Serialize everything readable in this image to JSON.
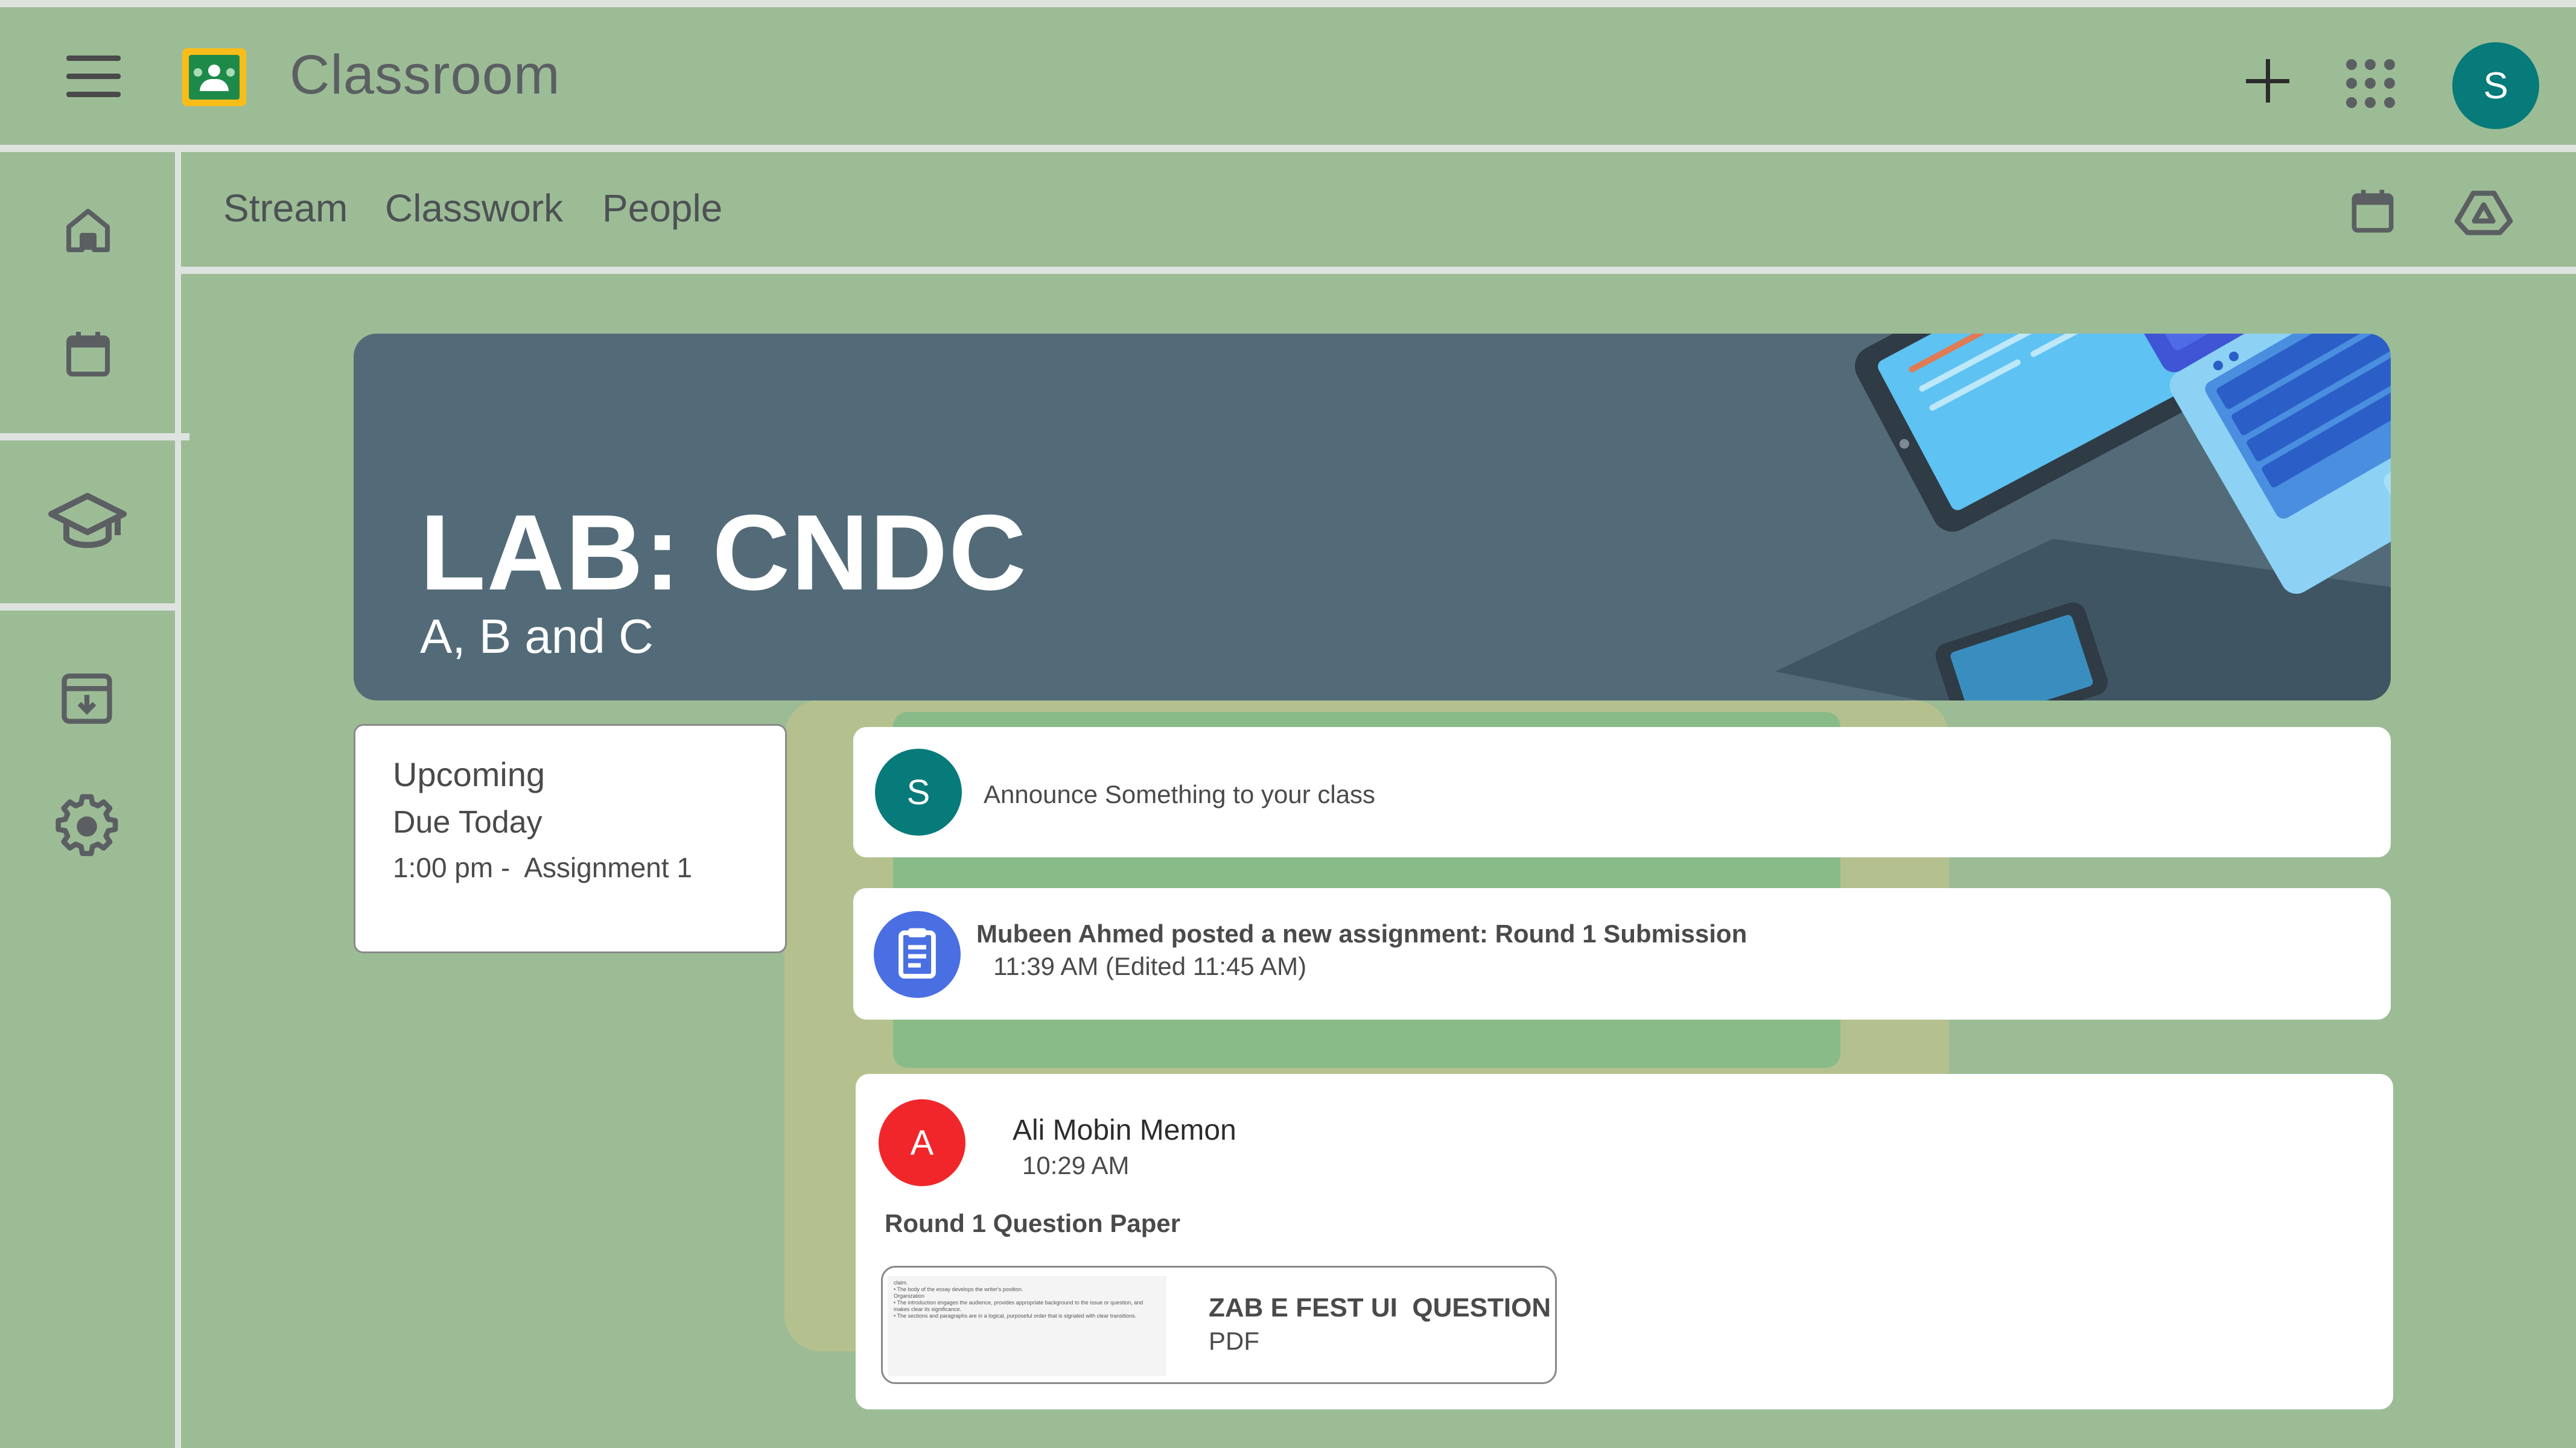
{
  "app": {
    "title": "Classroom"
  },
  "header": {
    "avatar_initial": "S"
  },
  "tabs": [
    {
      "label": "Stream"
    },
    {
      "label": "Classwork"
    },
    {
      "label": "People"
    }
  ],
  "banner": {
    "title": "LAB: CNDC",
    "subtitle": "A, B and C"
  },
  "upcoming": {
    "title": "Upcoming",
    "due_label": "Due Today",
    "item": "1:00 pm -  Assignment 1"
  },
  "announce": {
    "avatar_initial": "S",
    "placeholder": "Announce Something to your class"
  },
  "assignment_post": {
    "title": "Mubeen Ahmed posted a new assignment: Round 1 Submission",
    "time": "11:39 AM (Edited 11:45 AM)"
  },
  "post": {
    "avatar_initial": "A",
    "author": "Ali Mobin Memon",
    "time": "10:29 AM",
    "body": "Round 1 Question Paper",
    "attachment": {
      "thumbnail_text": "claim.\n• The body of the essay develops the writer's position.\nOrganization\n• The introduction engages the audience, provides appropriate background to the issue or question, and makes clear its significance.\n• The sections and paragraphs are in a logical, purposeful order that is signaled with clear transitions.",
      "name": "ZAB E FEST UI  QUESTION",
      "type": "PDF"
    }
  },
  "icons": {
    "menu": "menu-icon",
    "logo": "classroom-logo-icon",
    "plus": "plus-icon",
    "apps": "apps-grid-icon",
    "home": "home-icon",
    "calendar": "calendar-icon",
    "enrolled": "graduation-cap-icon",
    "archive": "archive-icon",
    "settings": "gear-icon",
    "drive": "drive-icon",
    "assignment": "assignment-clipboard-icon"
  },
  "colors": {
    "background": "#9cbc96",
    "banner": "#536b78",
    "avatar_teal": "#077a7a",
    "avatar_red": "#f1262a",
    "assignment_blue": "#4a6fe3"
  }
}
